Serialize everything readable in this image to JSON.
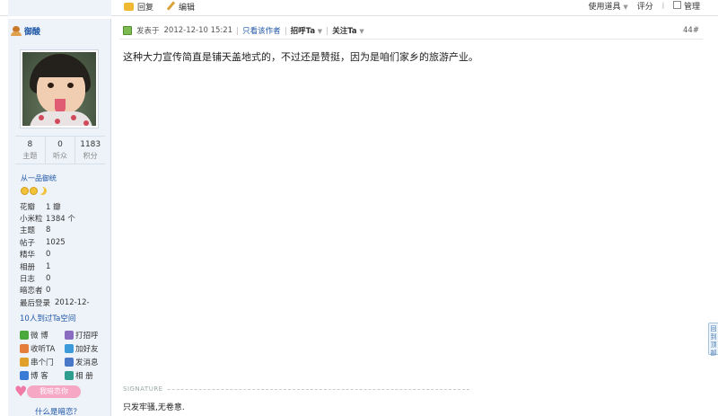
{
  "toolbar": {
    "reply_label": "回复",
    "edit_label": "编辑",
    "tools_label": "使用道具",
    "rate_label": "评分",
    "manage_label": "管理"
  },
  "user": {
    "name": "御酸",
    "stats": [
      {
        "num": "8",
        "label": "主题"
      },
      {
        "num": "0",
        "label": "听众"
      },
      {
        "num": "1183",
        "label": "积分"
      }
    ],
    "group": "从一品御统",
    "info": [
      {
        "k": "花瓣",
        "v": "1 瓣"
      },
      {
        "k": "小米粒",
        "v": "1384 个"
      },
      {
        "k": "主题",
        "v": "8"
      },
      {
        "k": "帖子",
        "v": "1025"
      },
      {
        "k": "精华",
        "v": "0"
      },
      {
        "k": "相册",
        "v": "1"
      },
      {
        "k": "日志",
        "v": "0"
      },
      {
        "k": "暗恋者",
        "v": "0"
      },
      {
        "k": "最后登录",
        "v": "2012-12-"
      }
    ],
    "visited_count": "10",
    "visited_text": "人到过Ta空间",
    "links": [
      {
        "a": "微 博",
        "b": "打招呼"
      },
      {
        "a": "收听TA",
        "b": "加好友"
      },
      {
        "a": "串个门",
        "b": "发消息"
      },
      {
        "a": "博 客",
        "b": "相 册"
      }
    ],
    "crush_button": "我暗恋你",
    "what_is_crush": "什么是暗恋？"
  },
  "post": {
    "posted_label": "发表于",
    "datetime": "2012-12-10 15:21",
    "only_author": "只看该作者",
    "greet": "招呼Ta",
    "follow": "关注Ta",
    "floor": "44#",
    "content": "这种大力宣传简直是铺天盖地式的，不过还是赞挺，因为是咱们家乡的旅游产业。",
    "signature_label": "SIGNATURE",
    "signature": "只发牢骚,无卷意."
  },
  "float_tab": "回到顶部"
}
